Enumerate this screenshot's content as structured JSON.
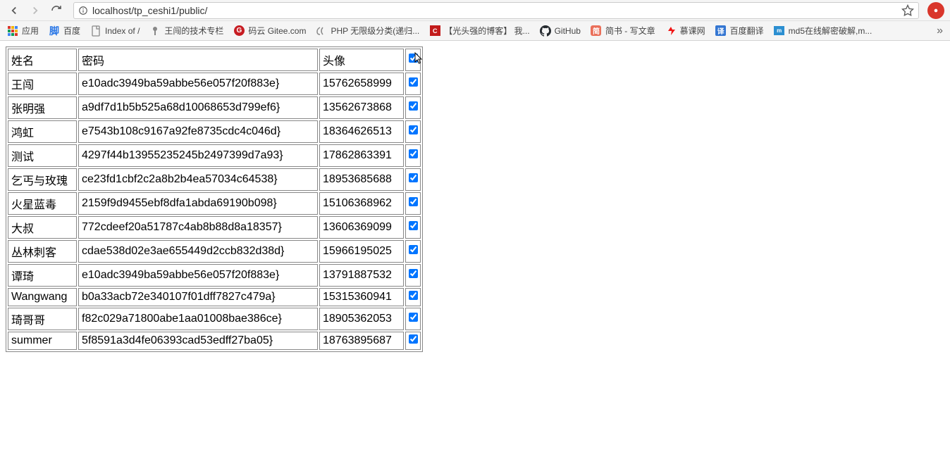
{
  "url": "localhost/tp_ceshi1/public/",
  "bookmarks": [
    {
      "label": "应用",
      "iconColor": "#4285f4",
      "type": "apps"
    },
    {
      "label": "百度",
      "iconColor": "#2a77e6",
      "type": "baidu"
    },
    {
      "label": "Index of /",
      "iconColor": "#777",
      "type": "doc"
    },
    {
      "label": "王闯的技术专栏",
      "iconColor": "#888",
      "type": "pin"
    },
    {
      "label": "码云 Gitee.com",
      "iconColor": "#c71d23",
      "type": "gitee"
    },
    {
      "label": "PHP 无限级分类(递归...",
      "iconColor": "#777",
      "type": "php"
    },
    {
      "label": "【光头强的博客】 我...",
      "iconColor": "#c21b1b",
      "type": "csdn"
    },
    {
      "label": "GitHub",
      "iconColor": "#000",
      "type": "github"
    },
    {
      "label": "简书 - 写文章",
      "iconColor": "#ea6f5a",
      "type": "jianshu"
    },
    {
      "label": "慕课网",
      "iconColor": "#f01414",
      "type": "imooc"
    },
    {
      "label": "百度翻译",
      "iconColor": "#3476d2",
      "type": "fanyi"
    },
    {
      "label": "md5在线解密破解,m...",
      "iconColor": "#2c8fd1",
      "type": "md5"
    }
  ],
  "table": {
    "headers": {
      "name": "姓名",
      "password": "密码",
      "avatar": "头像"
    },
    "rows": [
      {
        "name": "王闯",
        "password": "e10adc3949ba59abbe56e057f20f883e}",
        "avatar": "15762658999",
        "checked": true
      },
      {
        "name": "张明强",
        "password": "a9df7d1b5b525a68d10068653d799ef6}",
        "avatar": "13562673868",
        "checked": true
      },
      {
        "name": "鸿虹",
        "password": "e7543b108c9167a92fe8735cdc4c046d}",
        "avatar": "18364626513",
        "checked": true
      },
      {
        "name": "测试",
        "password": "4297f44b13955235245b2497399d7a93}",
        "avatar": "17862863391",
        "checked": true
      },
      {
        "name": "乞丐与玫瑰",
        "password": "ce23fd1cbf2c2a8b2b4ea57034c64538}",
        "avatar": "18953685688",
        "checked": true
      },
      {
        "name": "火星蓝毒",
        "password": "2159f9d9455ebf8dfa1abda69190b098}",
        "avatar": "15106368962",
        "checked": true
      },
      {
        "name": "大叔",
        "password": "772cdeef20a51787c4ab8b88d8a18357}",
        "avatar": "13606369099",
        "checked": true
      },
      {
        "name": "丛林刺客",
        "password": "cdae538d02e3ae655449d2ccb832d38d}",
        "avatar": "15966195025",
        "checked": true
      },
      {
        "name": "谭琦",
        "password": "e10adc3949ba59abbe56e057f20f883e}",
        "avatar": "13791887532",
        "checked": true
      },
      {
        "name": "Wangwang",
        "password": "b0a33acb72e340107f01dff7827c479a}",
        "avatar": "15315360941",
        "checked": true
      },
      {
        "name": "琦哥哥",
        "password": "f82c029a71800abe1aa01008bae386ce}",
        "avatar": "18905362053",
        "checked": true
      },
      {
        "name": "summer",
        "password": "5f8591a3d4fe06393cad53edff27ba05}",
        "avatar": "18763895687",
        "checked": true
      }
    ]
  }
}
